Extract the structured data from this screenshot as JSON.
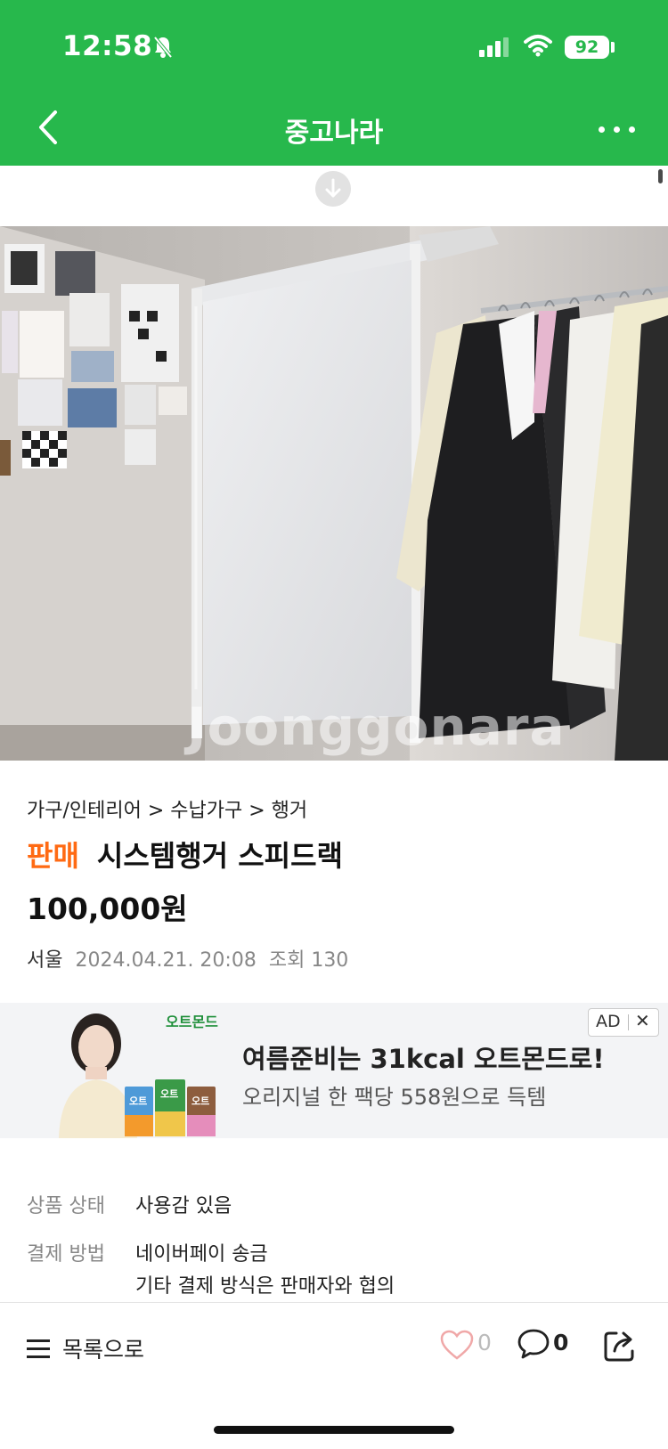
{
  "status_bar": {
    "time": "12:58",
    "battery": "92"
  },
  "nav": {
    "title": "중고나라"
  },
  "listing": {
    "breadcrumb": "가구/인테리어 > 수납가구 > 행거",
    "sale_tag": "판매",
    "title": "시스템행거 스피드랙",
    "price": "100,000원",
    "location": "서울",
    "date": "2024.04.21. 20:08",
    "views": "조회 130"
  },
  "photo": {
    "watermark": "Joonggonara"
  },
  "ad": {
    "brand": "오트몬드",
    "headline": "여름준비는 31kcal 오트몬드로!",
    "subtext": "오리지널 한 팩당 558원으로 득템",
    "badge": "AD"
  },
  "details": [
    {
      "label": "상품 상태",
      "value": "사용감 있음"
    },
    {
      "label": "결제 방법",
      "value": "네이버페이 송금",
      "value2": "기타 결제 방식은 판매자와 협의"
    }
  ],
  "bottom_bar": {
    "list_label": "목록으로",
    "likes": "0",
    "comments": "0"
  },
  "colors": {
    "brand_green": "#27b84c",
    "sale_orange": "#ff6a13"
  }
}
